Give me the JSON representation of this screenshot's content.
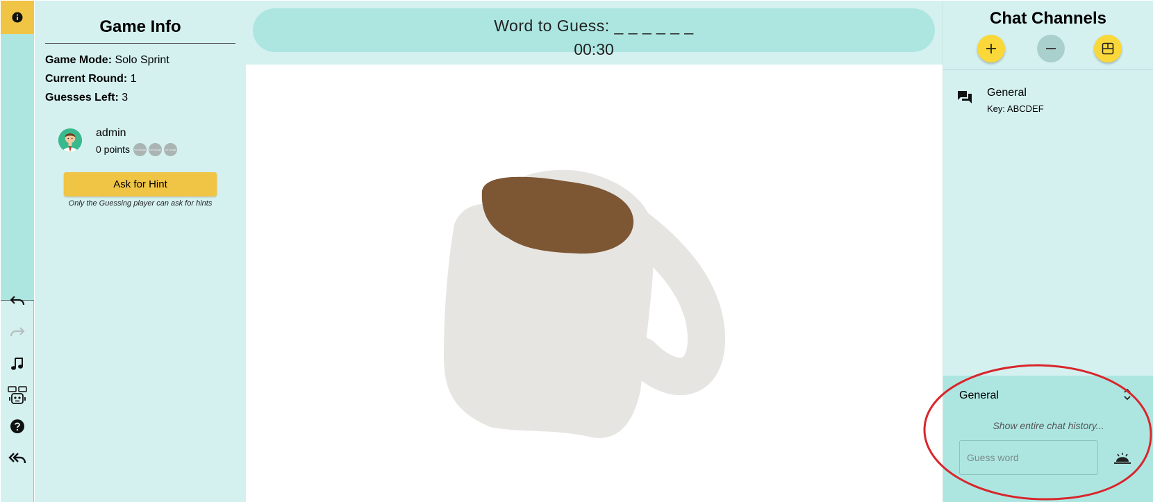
{
  "toolbar": {
    "info_icon": "info-icon",
    "tools": [
      "undo-icon",
      "redo-icon",
      "music-icon",
      "robot-icon",
      "help-icon",
      "exit-icon"
    ]
  },
  "game_info": {
    "title": "Game Info",
    "mode_label": "Game Mode:",
    "mode_value": "Solo Sprint",
    "round_label": "Current Round:",
    "round_value": "1",
    "guesses_label": "Guesses Left:",
    "guesses_value": "3",
    "player": {
      "name": "admin",
      "points": "0 points",
      "badge_text": "No badge"
    },
    "hint_button": "Ask for Hint",
    "hint_note": "Only the Guessing player can ask for hints"
  },
  "header": {
    "word": "Word to Guess: _ _ _ _ _ _",
    "timer": "00:30"
  },
  "chat": {
    "title": "Chat Channels",
    "channels": [
      {
        "name": "General",
        "key": "Key: ABCDEF"
      }
    ],
    "box": {
      "channel": "General",
      "history_link": "Show entire chat history...",
      "input_placeholder": "Guess word"
    }
  },
  "colors": {
    "panel": "#d4f1f0",
    "accent": "#ade6e1",
    "yellow": "#f0c445",
    "mug": "#e6e5e2",
    "coffee": "#7d5634",
    "highlight": "#d8262c"
  }
}
